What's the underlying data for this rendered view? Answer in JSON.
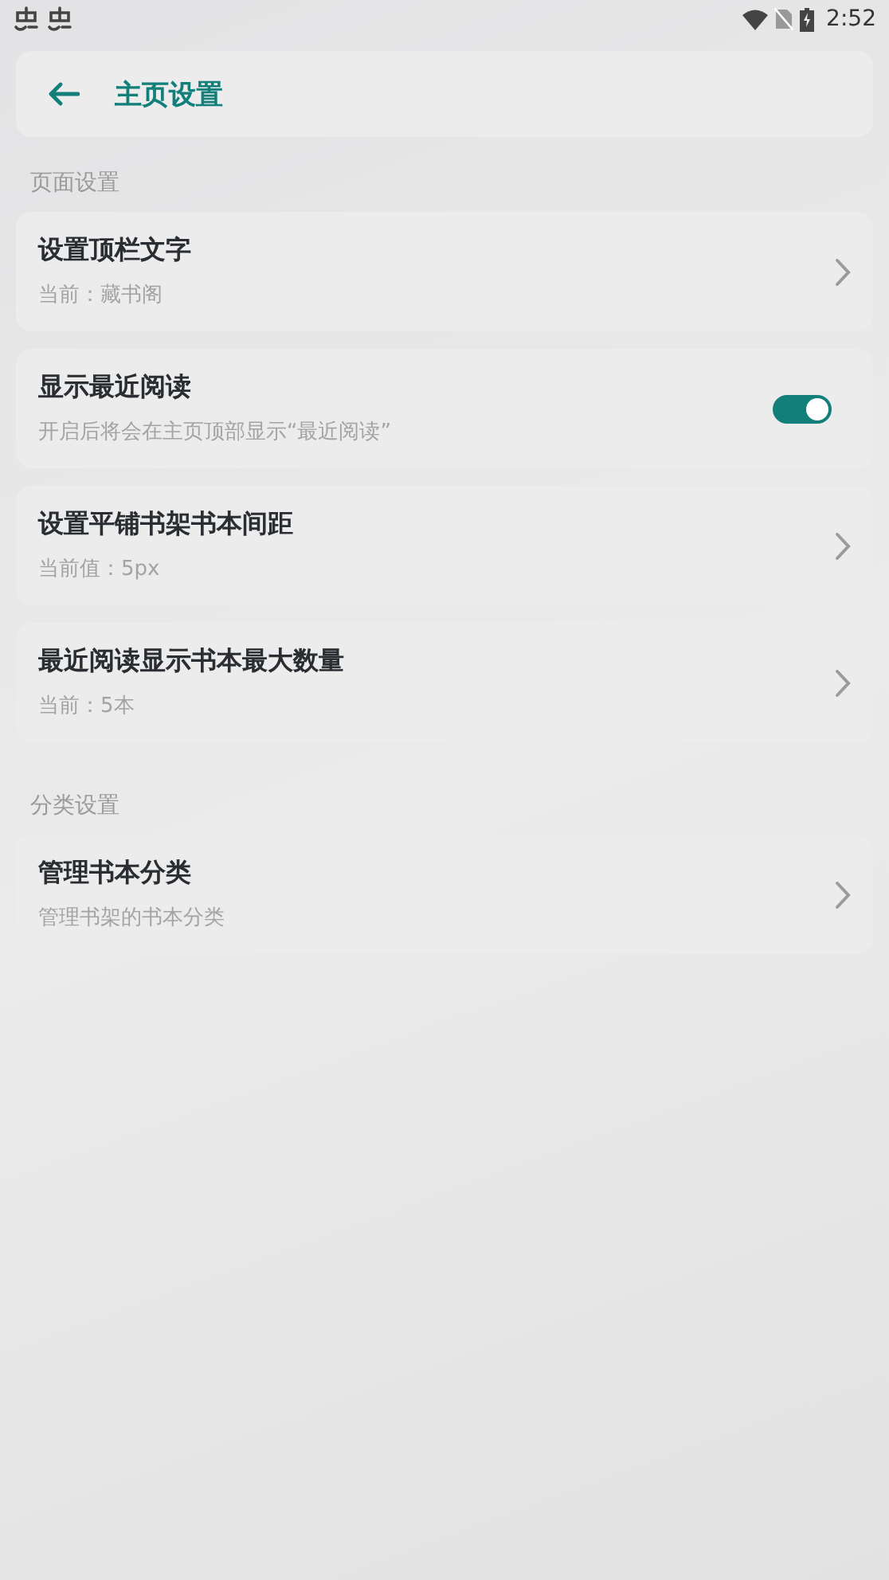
{
  "status_bar": {
    "time": "2:52"
  },
  "header": {
    "title": "主页设置"
  },
  "sections": [
    {
      "title": "页面设置",
      "items": [
        {
          "kind": "link",
          "title": "设置顶栏文字",
          "subtitle": "当前：藏书阁"
        },
        {
          "kind": "switch",
          "title": "显示最近阅读",
          "subtitle": "开启后将会在主页顶部显示“最近阅读”",
          "on": true
        },
        {
          "kind": "link",
          "title": "设置平铺书架书本间距",
          "subtitle": "当前值：5px"
        },
        {
          "kind": "link",
          "title": "最近阅读显示书本最大数量",
          "subtitle": "当前：5本"
        }
      ]
    },
    {
      "title": "分类设置",
      "items": [
        {
          "kind": "link",
          "title": "管理书本分类",
          "subtitle": "管理书架的书本分类"
        }
      ]
    }
  ]
}
